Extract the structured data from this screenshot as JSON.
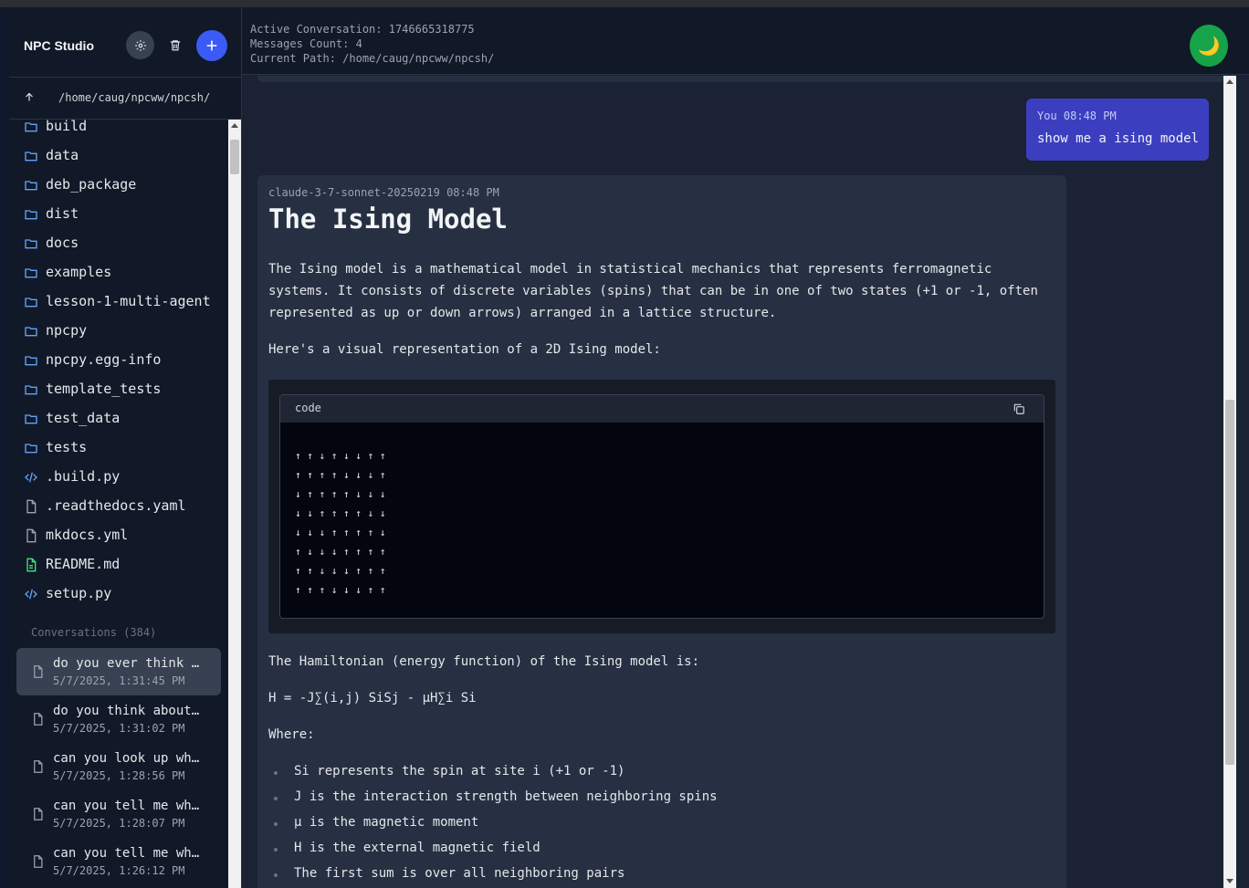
{
  "app": {
    "title": "NPC Studio"
  },
  "sidebar": {
    "current_path": "/home/caug/npcww/npcsh/",
    "files": [
      {
        "name": "build",
        "icon": "folder-icon"
      },
      {
        "name": "data",
        "icon": "folder-icon"
      },
      {
        "name": "deb_package",
        "icon": "folder-icon"
      },
      {
        "name": "dist",
        "icon": "folder-icon"
      },
      {
        "name": "docs",
        "icon": "folder-icon"
      },
      {
        "name": "examples",
        "icon": "folder-icon"
      },
      {
        "name": "lesson-1-multi-agent",
        "icon": "folder-icon"
      },
      {
        "name": "npcpy",
        "icon": "folder-icon"
      },
      {
        "name": "npcpy.egg-info",
        "icon": "folder-icon"
      },
      {
        "name": "template_tests",
        "icon": "folder-icon"
      },
      {
        "name": "test_data",
        "icon": "folder-icon"
      },
      {
        "name": "tests",
        "icon": "folder-icon"
      },
      {
        "name": ".build.py",
        "icon": "code-file-icon"
      },
      {
        "name": ".readthedocs.yaml",
        "icon": "file-icon"
      },
      {
        "name": "mkdocs.yml",
        "icon": "file-icon"
      },
      {
        "name": "README.md",
        "icon": "markdown-file-icon"
      },
      {
        "name": "setup.py",
        "icon": "code-file-icon"
      }
    ],
    "conversations_header": "Conversations (384)",
    "conversations": [
      {
        "title": "do you ever think about",
        "date": "5/7/2025, 1:31:45 PM",
        "active": true
      },
      {
        "title": "do you think about the",
        "date": "5/7/2025, 1:31:02 PM"
      },
      {
        "title": "can you look up what",
        "date": "5/7/2025, 1:28:56 PM"
      },
      {
        "title": "can you tell me what",
        "date": "5/7/2025, 1:28:07 PM"
      },
      {
        "title": "can you tell me what",
        "date": "5/7/2025, 1:26:12 PM"
      }
    ]
  },
  "info": {
    "active_conversation": "Active Conversation: 1746665318775",
    "messages_count": "Messages Count: 4",
    "current_path": "Current Path: /home/caug/npcww/npcsh/"
  },
  "theme_icon": "🌙",
  "colors": {
    "accent": "#3b5bf6",
    "user_bubble": "#3b3fbf",
    "theme_button": "#16a34a"
  },
  "messages": {
    "user": {
      "meta": "You 08:48 PM",
      "text": "show me a ising model"
    },
    "assistant": {
      "meta": "claude-3-7-sonnet-20250219 08:48 PM",
      "heading": "The Ising Model",
      "para1": "The Ising model is a mathematical model in statistical mechanics that represents ferromagnetic systems. It consists of discrete variables (spins) that can be in one of two states (+1 or -1, often represented as up or down arrows) arranged in a lattice structure.",
      "para2": "Here's a visual representation of a 2D Ising model:",
      "code_label": "code",
      "code": "↑ ↑ ↓ ↑ ↓ ↓ ↑ ↑\n↑ ↑ ↑ ↑ ↓ ↓ ↓ ↑\n↓ ↑ ↑ ↑ ↑ ↓ ↓ ↓\n↓ ↓ ↑ ↑ ↑ ↑ ↓ ↓\n↓ ↓ ↓ ↑ ↑ ↑ ↑ ↓\n↑ ↓ ↓ ↓ ↑ ↑ ↑ ↑\n↑ ↑ ↓ ↓ ↓ ↑ ↑ ↑\n↑ ↑ ↑ ↓ ↓ ↓ ↑ ↑",
      "para3": "The Hamiltonian (energy function) of the Ising model is:",
      "formula": "H = -J∑(i,j) SiSj - μH∑i Si",
      "where": "Where:",
      "bullets": [
        "Si represents the spin at site i (+1 or -1)",
        "J is the interaction strength between neighboring spins",
        "μ is the magnetic moment",
        "H is the external magnetic field",
        "The first sum is over all neighboring pairs"
      ]
    }
  }
}
